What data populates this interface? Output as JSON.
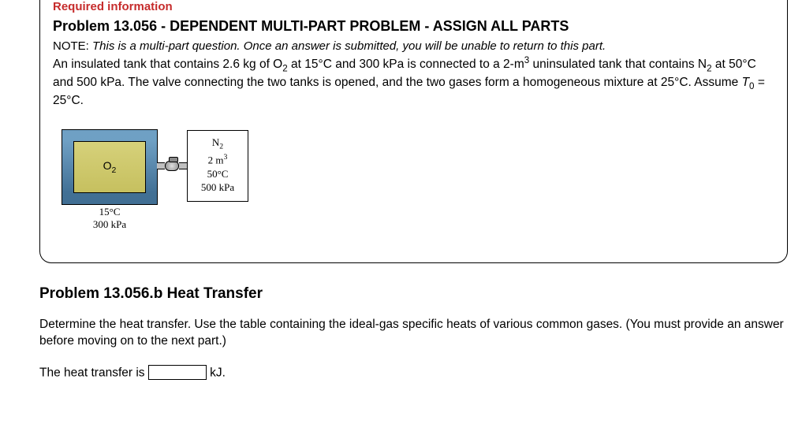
{
  "header": {
    "required_info": "Required information",
    "title": "Problem 13.056 - DEPENDENT MULTI-PART PROBLEM - ASSIGN ALL PARTS"
  },
  "note": {
    "label": "NOTE:",
    "text": "This is a multi-part question. Once an answer is submitted, you will be unable to return to this part."
  },
  "body": {
    "seg1": "An insulated tank that contains 2.6 kg of O",
    "sub1": "2",
    "seg2": " at 15°C and 300 kPa is connected to a 2-m",
    "sup1": "3",
    "seg3": " uninsulated tank that contains N",
    "sub2": "2",
    "seg4": " at 50°C and 500 kPa. The valve connecting the two tanks is opened, and the two gases form a homogeneous mixture at 25°C. Assume ",
    "tvar": "T",
    "tsub": "0",
    "seg5": " = 25°C."
  },
  "diagram": {
    "tank1": {
      "gas": "O",
      "gas_sub": "2",
      "temp": "15°C",
      "press": "300 kPa"
    },
    "tank2": {
      "gas": "N",
      "gas_sub": "2",
      "vol": "2 m",
      "vol_sup": "3",
      "temp": "50°C",
      "press": "500 kPa"
    }
  },
  "sub": {
    "title": "Problem 13.056.b Heat Transfer",
    "body": "Determine the heat transfer. Use the table containing the ideal-gas specific heats of various common gases. (You must provide an answer before moving on to the next part.)",
    "answer_label_pre": "The heat transfer is ",
    "answer_value": "",
    "answer_unit": " kJ."
  }
}
